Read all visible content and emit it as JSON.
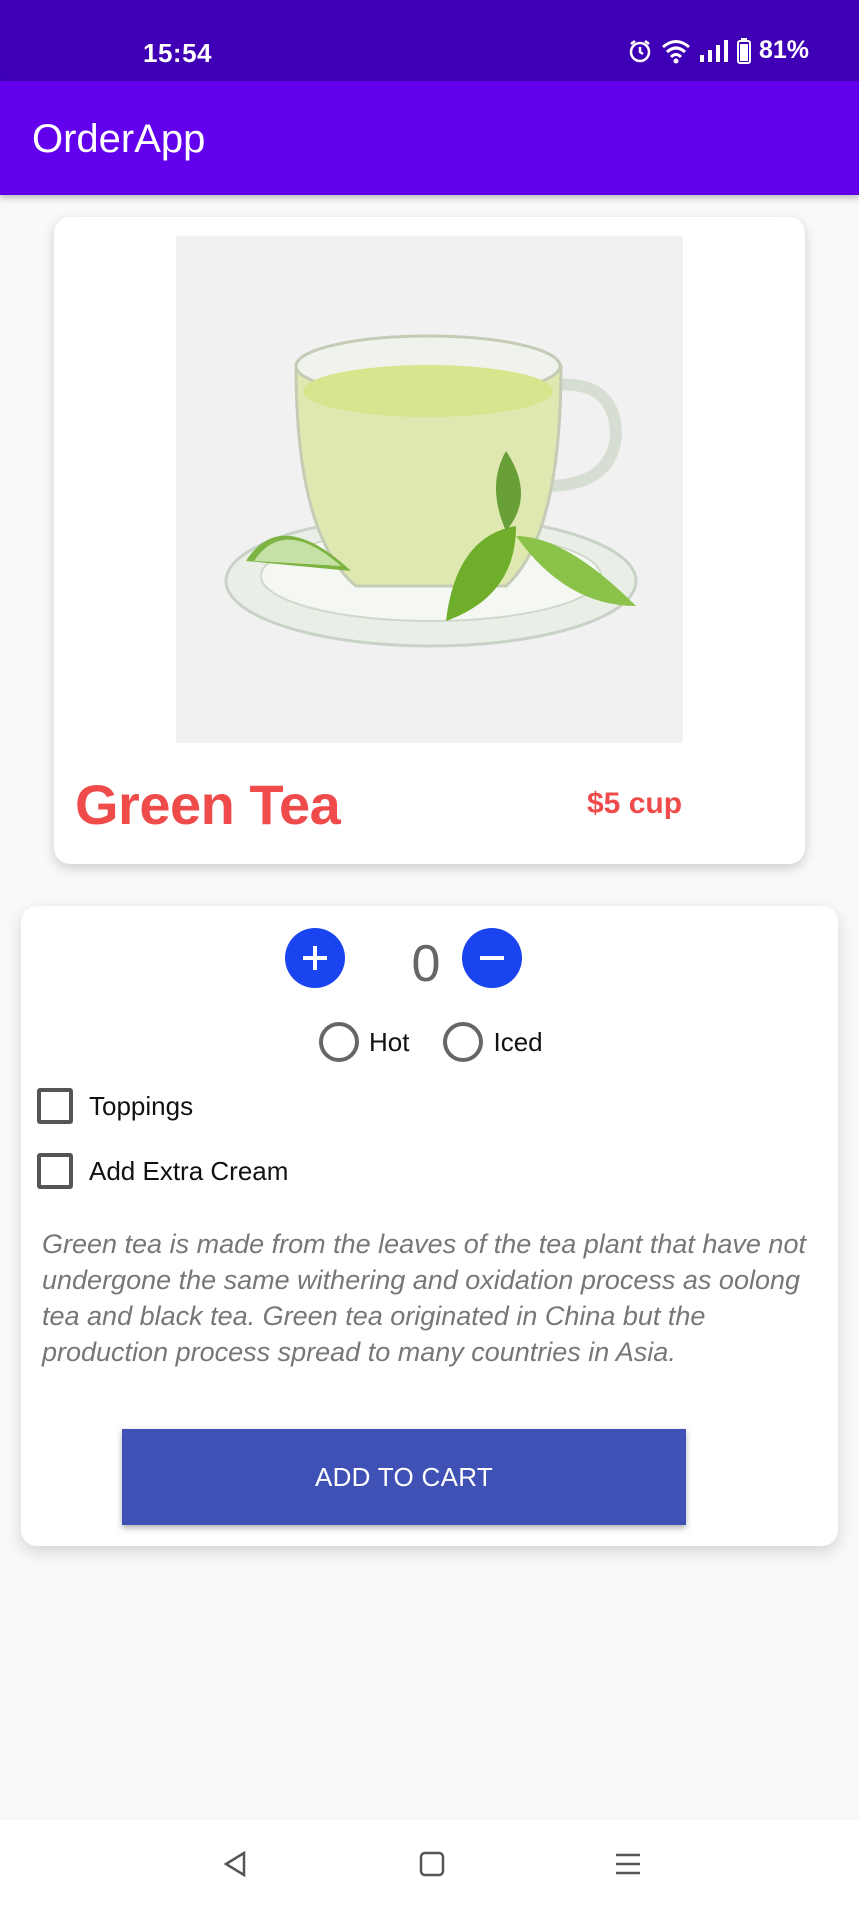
{
  "status_bar": {
    "time": "15:54",
    "battery": "81%"
  },
  "app_bar": {
    "title": "OrderApp"
  },
  "product": {
    "name": "Green Tea",
    "price": "$5 cup",
    "image_icon": "green-tea-cup-image",
    "accent_color": "#ef4b4b"
  },
  "order": {
    "quantity": "0",
    "increment_icon": "plus-icon",
    "decrement_icon": "minus-icon",
    "temperature_options": [
      {
        "label": "Hot",
        "selected": false
      },
      {
        "label": "Iced",
        "selected": false
      }
    ],
    "extras": [
      {
        "label": "Toppings",
        "checked": false
      },
      {
        "label": "Add Extra Cream",
        "checked": false
      }
    ],
    "description": "Green tea is made from the leaves of the tea plant that have not undergone the same withering and oxidation process as oolong tea and black tea. Green tea originated in China but the production process spread to many countries in Asia.",
    "add_to_cart_label": "ADD TO CART"
  },
  "colors": {
    "status_bar": "#3f00b5",
    "app_bar": "#6200ee",
    "qty_button": "#1a44f0",
    "cart_button": "#3f51b5"
  }
}
